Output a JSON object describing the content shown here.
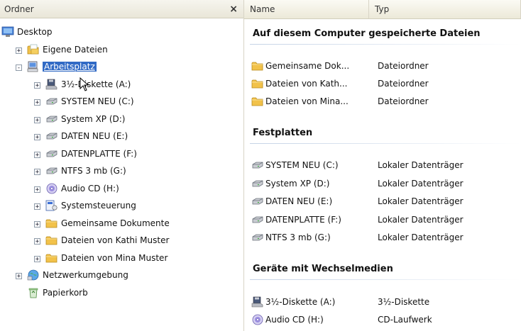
{
  "left_pane": {
    "title": "Ordner",
    "close_symbol": "×",
    "tree": [
      {
        "label": "Desktop",
        "icon": "desktop-icon",
        "level": 0,
        "toggle": ""
      },
      {
        "label": "Eigene Dateien",
        "icon": "my-documents-icon",
        "level": 1,
        "toggle": "+"
      },
      {
        "label": "Arbeitsplatz",
        "icon": "my-computer-icon",
        "level": 1,
        "toggle": "-",
        "selected": true
      },
      {
        "label": "3½-Diskette (A:)",
        "icon": "floppy-drive-icon",
        "level": 2,
        "toggle": "+"
      },
      {
        "label": "SYSTEM NEU (C:)",
        "icon": "hard-drive-icon",
        "level": 2,
        "toggle": "+"
      },
      {
        "label": "System XP (D:)",
        "icon": "hard-drive-icon",
        "level": 2,
        "toggle": "+"
      },
      {
        "label": "DATEN NEU (E:)",
        "icon": "hard-drive-icon",
        "level": 2,
        "toggle": "+"
      },
      {
        "label": "DATENPLATTE (F:)",
        "icon": "hard-drive-icon",
        "level": 2,
        "toggle": "+"
      },
      {
        "label": "NTFS 3 mb (G:)",
        "icon": "hard-drive-icon",
        "level": 2,
        "toggle": "+"
      },
      {
        "label": "Audio CD (H:)",
        "icon": "cd-drive-icon",
        "level": 2,
        "toggle": "+"
      },
      {
        "label": "Systemsteuerung",
        "icon": "control-panel-icon",
        "level": 2,
        "toggle": "+"
      },
      {
        "label": "Gemeinsame Dokumente",
        "icon": "folder-icon",
        "level": 2,
        "toggle": "+"
      },
      {
        "label": "Dateien von Kathi Muster",
        "icon": "folder-icon",
        "level": 2,
        "toggle": "+"
      },
      {
        "label": "Dateien von Mina Muster",
        "icon": "folder-icon",
        "level": 2,
        "toggle": "+"
      },
      {
        "label": "Netzwerkumgebung",
        "icon": "network-icon",
        "level": 1,
        "toggle": "+"
      },
      {
        "label": "Papierkorb",
        "icon": "recycle-bin-icon",
        "level": 1,
        "toggle": ""
      }
    ]
  },
  "right_pane": {
    "columns": {
      "name": "Name",
      "type": "Typ"
    },
    "groups": [
      {
        "title": "Auf diesem Computer gespeicherte Dateien",
        "items": [
          {
            "name": "Gemeinsame Dok...",
            "type": "Dateiordner",
            "icon": "folder-icon"
          },
          {
            "name": "Dateien von Kath...",
            "type": "Dateiordner",
            "icon": "folder-icon"
          },
          {
            "name": "Dateien von Mina...",
            "type": "Dateiordner",
            "icon": "folder-icon"
          }
        ]
      },
      {
        "title": "Festplatten",
        "items": [
          {
            "name": "SYSTEM NEU (C:)",
            "type": "Lokaler Datenträger",
            "icon": "hard-drive-icon"
          },
          {
            "name": "System XP (D:)",
            "type": "Lokaler Datenträger",
            "icon": "hard-drive-icon"
          },
          {
            "name": "DATEN NEU (E:)",
            "type": "Lokaler Datenträger",
            "icon": "hard-drive-icon"
          },
          {
            "name": "DATENPLATTE (F:)",
            "type": "Lokaler Datenträger",
            "icon": "hard-drive-icon"
          },
          {
            "name": "NTFS 3 mb (G:)",
            "type": "Lokaler Datenträger",
            "icon": "hard-drive-icon"
          }
        ]
      },
      {
        "title": "Geräte mit Wechselmedien",
        "items": [
          {
            "name": "3½-Diskette (A:)",
            "type": "3½-Diskette",
            "icon": "floppy-drive-icon"
          },
          {
            "name": "Audio CD (H:)",
            "type": "CD-Laufwerk",
            "icon": "cd-drive-icon"
          }
        ]
      }
    ]
  },
  "colors": {
    "selection": "#316ac5",
    "folder": "#f2c24a",
    "header_bg": "#ece9d8"
  }
}
